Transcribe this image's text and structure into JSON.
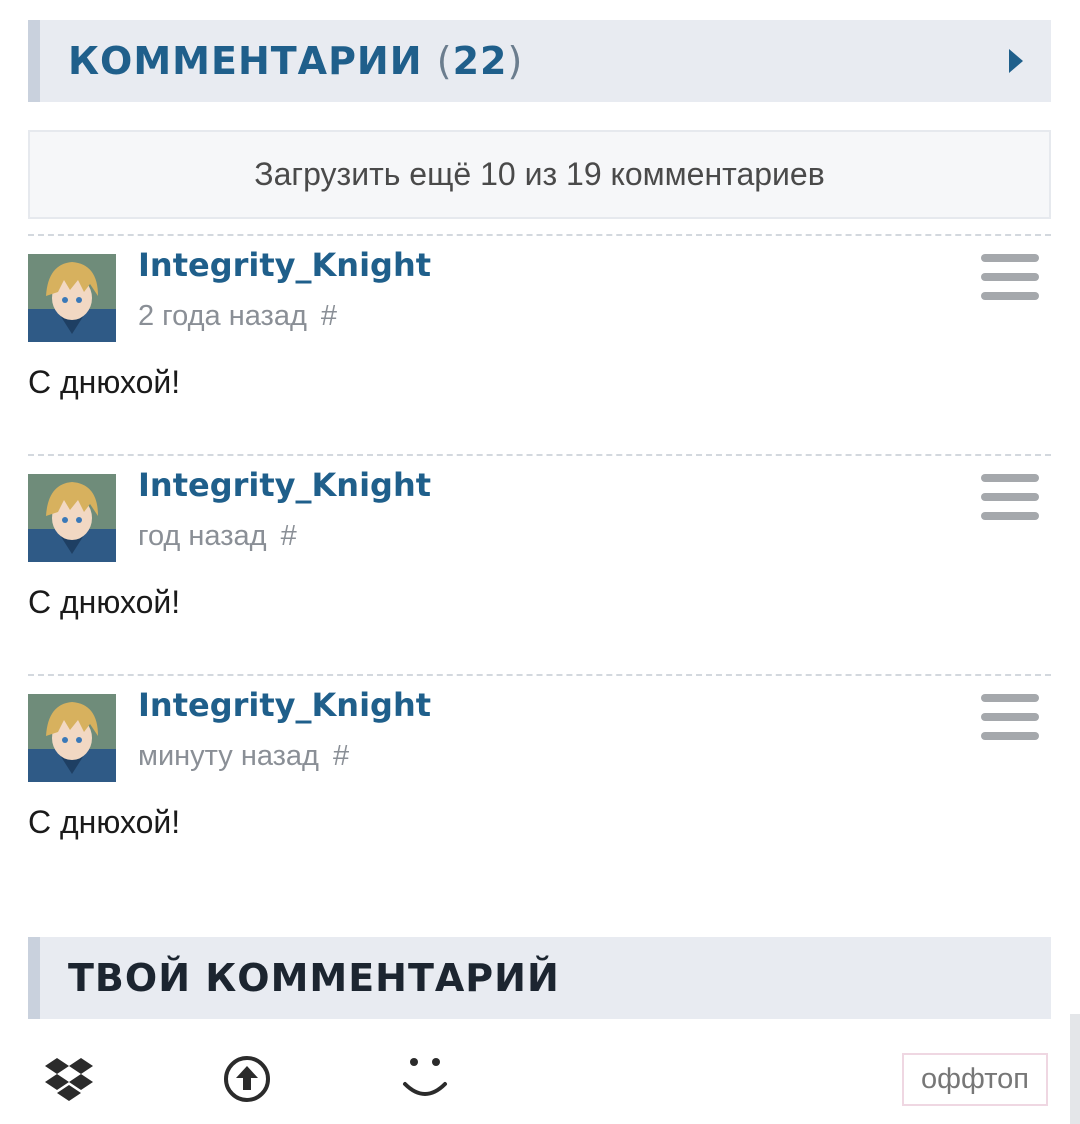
{
  "comments_section": {
    "title": "КОММЕНТАРИИ",
    "paren_open": "(",
    "count": "22",
    "paren_close": ")"
  },
  "load_more": {
    "label": "Загрузить ещё 10 из 19 комментариев"
  },
  "comments": [
    {
      "author": "Integrity_Knight",
      "time": "2 года назад",
      "anchor": "#",
      "text": "С днюхой!"
    },
    {
      "author": "Integrity_Knight",
      "time": "год назад",
      "anchor": "#",
      "text": "С днюхой!"
    },
    {
      "author": "Integrity_Knight",
      "time": "минуту назад",
      "anchor": "#",
      "text": "С днюхой!"
    }
  ],
  "your_comment": {
    "title": "ТВОЙ КОММЕНТАРИЙ"
  },
  "toolbar": {
    "icons": [
      "dropbox-icon",
      "upload-icon",
      "smiley-icon"
    ],
    "offtop_label": "оффтоп"
  },
  "colors": {
    "accent": "#1f5f8b",
    "header_bg": "#e8ebf1",
    "header_border": "#c9d1dd",
    "meta_text": "#8a8f96",
    "offtop_border": "#efd7e2"
  }
}
